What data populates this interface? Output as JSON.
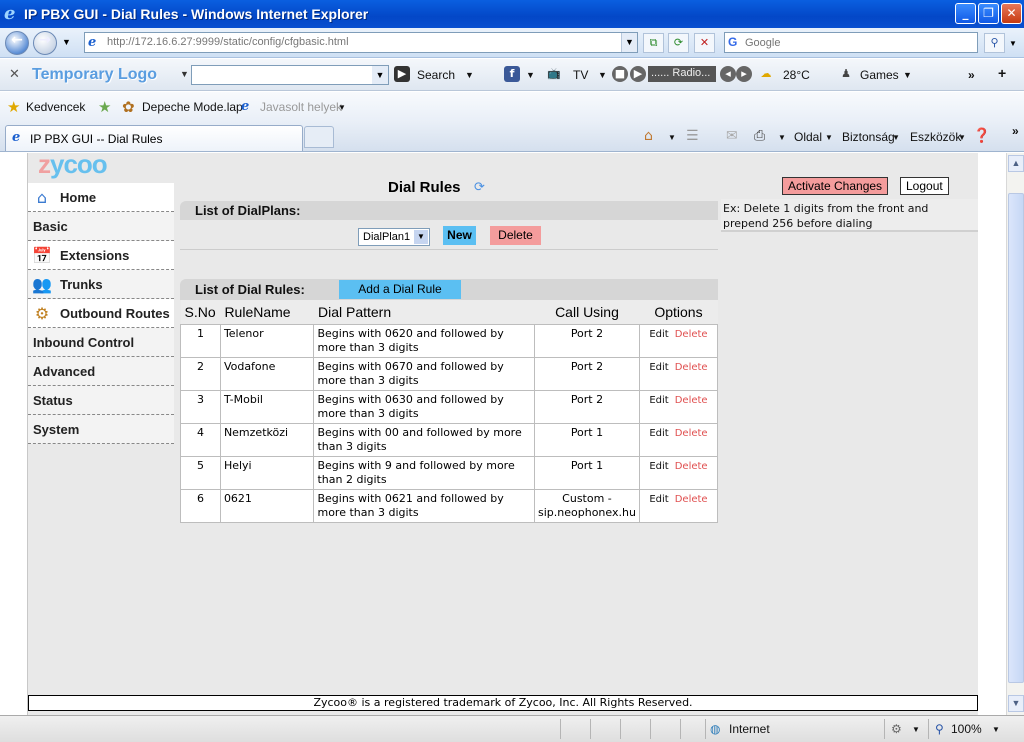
{
  "window": {
    "title": "IP PBX GUI - Dial Rules - Windows Internet Explorer",
    "url": "http://172.16.6.27:9999/static/config/cfgbasic.html",
    "search_placeholder": "Google"
  },
  "toolbar": {
    "logo": "Temporary Logo",
    "search_label": "Search",
    "tv_label": "TV",
    "radio_label": "...... Radio...",
    "weather": "28°C",
    "games": "Games"
  },
  "favorites": {
    "kedvencek": "Kedvencek",
    "items": [
      "Depeche Mode.lap",
      "Javasolt helyek"
    ]
  },
  "tabs": {
    "active": "IP PBX GUI -- Dial Rules"
  },
  "commands": {
    "oldal": "Oldal",
    "biztonsag": "Biztonság",
    "eszkozok": "Eszközök"
  },
  "sidebar": {
    "items": [
      {
        "label": "Home",
        "icon": "home-icon"
      },
      {
        "label": "Basic",
        "icon": ""
      },
      {
        "label": "Extensions",
        "icon": "calendar-icon"
      },
      {
        "label": "Trunks",
        "icon": "users-icon"
      },
      {
        "label": "Outbound Routes",
        "icon": "routes-icon"
      },
      {
        "label": "Inbound Control",
        "icon": ""
      },
      {
        "label": "Advanced",
        "icon": ""
      },
      {
        "label": "Status",
        "icon": ""
      },
      {
        "label": "System",
        "icon": ""
      }
    ]
  },
  "main": {
    "title": "Dial Rules",
    "activate_label": "Activate Changes",
    "logout_label": "Logout",
    "hint": "Ex: Delete 1 digits from the front and prepend 256 before dialing",
    "plans_header": "List of DialPlans:",
    "plan_selected": "DialPlan1",
    "new_label": "New",
    "delete_label": "Delete",
    "rules_header": "List of Dial Rules:",
    "add_rule_label": "Add a Dial Rule"
  },
  "table": {
    "columns": [
      "S.No",
      "RuleName",
      "Dial Pattern",
      "Call Using",
      "Options"
    ],
    "edit_label": "Edit",
    "delete_label": "Delete",
    "rows": [
      {
        "sno": "1",
        "name": "Telenor",
        "pattern": "Begins with 0620 and followed by more than 3 digits",
        "using": "Port 2"
      },
      {
        "sno": "2",
        "name": "Vodafone",
        "pattern": "Begins with 0670 and followed by more than 3 digits",
        "using": "Port 2"
      },
      {
        "sno": "3",
        "name": "T-Mobil",
        "pattern": "Begins with 0630 and followed by more than 3 digits",
        "using": "Port 2"
      },
      {
        "sno": "4",
        "name": "Nemzetközi",
        "pattern": "Begins with 00 and followed by more than 3 digits",
        "using": "Port 1"
      },
      {
        "sno": "5",
        "name": "Helyi",
        "pattern": "Begins with 9 and followed by more than 2 digits",
        "using": "Port 1"
      },
      {
        "sno": "6",
        "name": "0621",
        "pattern": "Begins with 0621 and followed by more than 3 digits",
        "using": "Custom - sip.neophonex.hu"
      }
    ]
  },
  "footer": "Zycoo® is a registered trademark of Zycoo, Inc. All Rights Reserved.",
  "statusbar": {
    "zone": "Internet",
    "zoom": "100%"
  }
}
